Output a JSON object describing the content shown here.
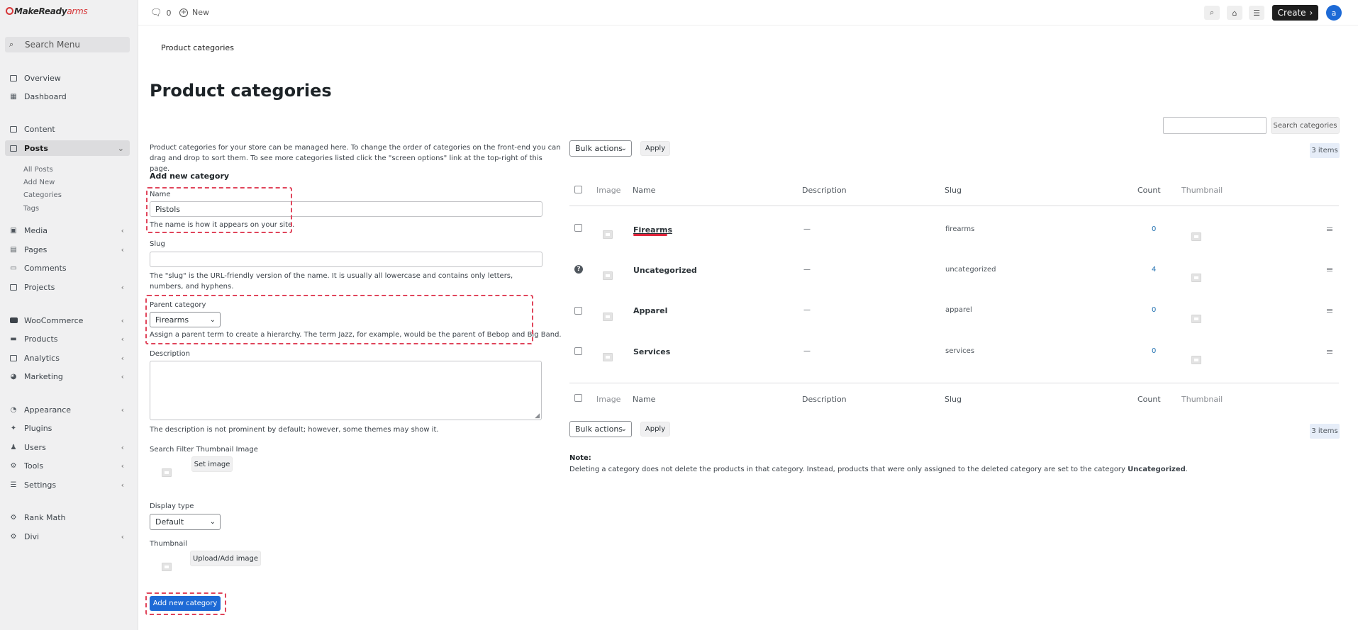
{
  "brand": {
    "name_main": "MakeReady",
    "name_accent": "arms"
  },
  "sidebar": {
    "search_label": "Search Menu",
    "items": [
      {
        "label": "Overview"
      },
      {
        "label": "Dashboard"
      },
      {
        "label": "Content"
      },
      {
        "label": "Posts"
      },
      {
        "label": "Media"
      },
      {
        "label": "Pages"
      },
      {
        "label": "Comments"
      },
      {
        "label": "Projects"
      },
      {
        "label": "WooCommerce"
      },
      {
        "label": "Products"
      },
      {
        "label": "Analytics"
      },
      {
        "label": "Marketing"
      },
      {
        "label": "Appearance"
      },
      {
        "label": "Plugins"
      },
      {
        "label": "Users"
      },
      {
        "label": "Tools"
      },
      {
        "label": "Settings"
      },
      {
        "label": "Rank Math"
      },
      {
        "label": "Divi"
      }
    ],
    "posts_sub": [
      "All Posts",
      "Add New",
      "Categories",
      "Tags"
    ]
  },
  "topbar": {
    "comments_count": "0",
    "new_label": "New",
    "create_label": "Create",
    "avatar_letter": "a"
  },
  "breadcrumb": "Product categories",
  "page_title": "Product categories",
  "search": {
    "button_label": "Search categories"
  },
  "form": {
    "intro": "Product categories for your store can be managed here. To change the order of categories on the front-end you can drag and drop to sort them. To see more categories listed click the \"screen options\" link at the top-right of this page.",
    "heading": "Add new category",
    "name_label": "Name",
    "name_value": "Pistols",
    "name_help": "The name is how it appears on your site.",
    "slug_label": "Slug",
    "slug_help": "The \"slug\" is the URL-friendly version of the name. It is usually all lowercase and contains only letters, numbers, and hyphens.",
    "parent_label": "Parent category",
    "parent_value": "Firearms",
    "parent_help": "Assign a parent term to create a hierarchy. The term Jazz, for example, would be the parent of Bebop and Big Band.",
    "description_label": "Description",
    "description_help": "The description is not prominent by default; however, some themes may show it.",
    "filter_thumb_label": "Search Filter Thumbnail Image",
    "set_image_label": "Set image",
    "display_type_label": "Display type",
    "display_type_value": "Default",
    "thumbnail_label": "Thumbnail",
    "upload_label": "Upload/Add image",
    "submit_label": "Add new category"
  },
  "table": {
    "bulk_label": "Bulk actions",
    "apply_label": "Apply",
    "items_count": "3 items",
    "columns": [
      "Image",
      "Name",
      "Description",
      "Slug",
      "Count",
      "Thumbnail"
    ],
    "rows": [
      {
        "name": "Firearms",
        "description": "—",
        "slug": "firearms",
        "count": "0"
      },
      {
        "name": "Uncategorized",
        "description": "—",
        "slug": "uncategorized",
        "count": "4"
      },
      {
        "name": "Apparel",
        "description": "—",
        "slug": "apparel",
        "count": "0"
      },
      {
        "name": "Services",
        "description": "—",
        "slug": "services",
        "count": "0"
      }
    ],
    "note_label": "Note:",
    "note_text": "Deleting a category does not delete the products in that category. Instead, products that were only assigned to the deleted category are set to the category",
    "note_bold": "Uncategorized",
    "note_end": "."
  },
  "colors": {
    "accent": "#1d6ad6",
    "highlight": "#e0455b"
  }
}
